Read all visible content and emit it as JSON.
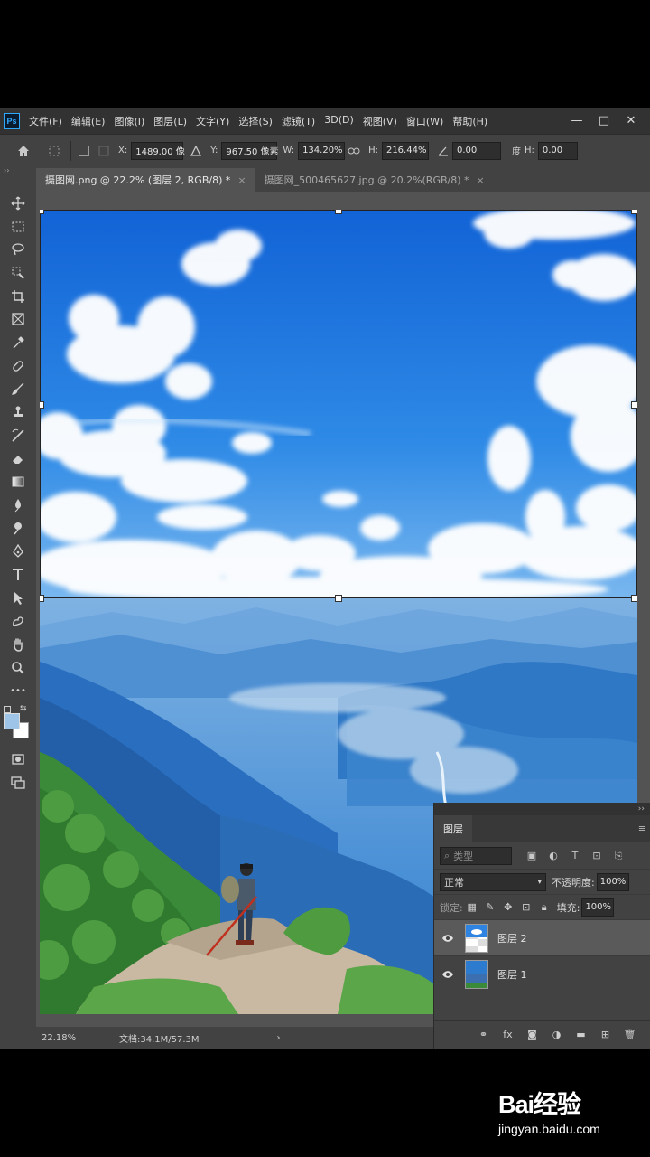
{
  "app": {
    "logo": "Ps"
  },
  "menu": [
    "文件(F)",
    "编辑(E)",
    "图像(I)",
    "图层(L)",
    "文字(Y)",
    "选择(S)",
    "滤镜(T)",
    "3D(D)",
    "视图(V)",
    "窗口(W)",
    "帮助(H)"
  ],
  "window_controls": {
    "minimize": "—",
    "restore": "□",
    "close": "✕"
  },
  "options": {
    "x_label": "X:",
    "x_value": "1489.00 像",
    "y_label": "Y:",
    "y_value": "967.50 像素",
    "w_label": "W:",
    "w_value": "134.20%",
    "h_label": "H:",
    "h_value": "216.44%",
    "angle_value": "0.00",
    "angle_unit": "度",
    "hskew_label": "H:",
    "hskew_value": "0.00"
  },
  "tabs": [
    {
      "label": "摄图网.png @ 22.2% (图层 2, RGB/8) *",
      "close": "×"
    },
    {
      "label": "摄图网_500465627.jpg @ 20.2%(RGB/8) *",
      "close": "×"
    }
  ],
  "toolbar": {
    "grip": "››",
    "more": "•••"
  },
  "colors": {
    "foreground": "#9ec4e8",
    "background": "#ffffff",
    "accent": "#31a8ff"
  },
  "status": {
    "zoom": "22.18%",
    "doc": "文档:34.1M/57.3M",
    "arrow": "›"
  },
  "layers_panel": {
    "collapse": "››",
    "tab": "图层",
    "menu": "≡",
    "filter_placeholder": "类型",
    "blend_mode": "正常",
    "opacity_label": "不透明度:",
    "opacity_value": "100%",
    "lock_label": "锁定:",
    "fill_label": "填充:",
    "fill_value": "100%",
    "layers": [
      {
        "name": "图层 2",
        "selected": true
      },
      {
        "name": "图层 1",
        "selected": false
      }
    ]
  },
  "watermark": {
    "logo": "Bai经验",
    "url": "jingyan.baidu.com"
  }
}
